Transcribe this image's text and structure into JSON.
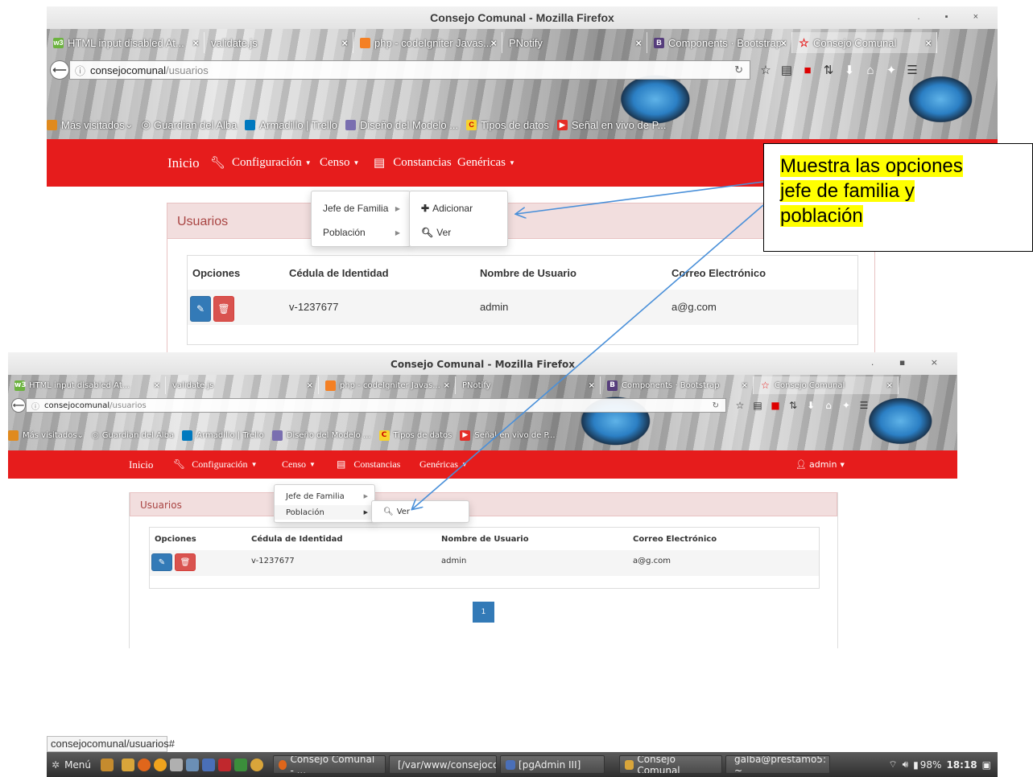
{
  "window1": {
    "title": "Consejo Comunal - Mozilla Firefox",
    "window_controls": ". ▪ ×",
    "tabs": [
      {
        "label": "HTML input disabled At...",
        "close": "×",
        "fav_color": "#6cb33f",
        "fav_text": "w3"
      },
      {
        "label": "validate.js",
        "close": "×",
        "fav_color": "",
        "fav_text": ""
      },
      {
        "label": "php - codeIgniter Javas...",
        "close": "×",
        "fav_color": "#f48024",
        "fav_text": ""
      },
      {
        "label": "PNotify",
        "close": "×",
        "fav_color": "",
        "fav_text": ""
      },
      {
        "label": "Components · Bootstrap",
        "close": "×",
        "fav_color": "#563d7c",
        "fav_text": "B"
      },
      {
        "label": "Consejo Comunal",
        "close": "×",
        "fav_color": "#e61c1c",
        "fav_text": "☆"
      }
    ],
    "url_host": "consejocomunal",
    "url_path": "/usuarios",
    "bookmarks": [
      "Más visitados",
      "Guardian del Alba",
      "Armadillo | Trello",
      "Diseño del Modelo ...",
      "Tipos de datos",
      "Señal en vivo de P..."
    ],
    "nav": {
      "brand": "Inicio",
      "configuracion": "Configuración",
      "censo": "Censo",
      "constancias": "Constancias",
      "genericas": "Genéricas"
    },
    "dropdown": [
      "Jefe de Familia",
      "Población"
    ],
    "submenu": [
      "Adicionar",
      "Ver"
    ],
    "panel_title": "Usuarios",
    "table": {
      "headers": [
        "Opciones",
        "Cédula de Identidad",
        "Nombre de Usuario",
        "Correo Electrónico"
      ],
      "row": {
        "cedula": "v-1237677",
        "usuario": "admin",
        "correo": "a@g.com"
      }
    }
  },
  "window2": {
    "title": "Consejo Comunal - Mozilla Firefox",
    "window_controls": ". ▪ ×",
    "tabs": [
      {
        "label": "HTML input disabled At...",
        "close": "×",
        "fav_color": "#6cb33f",
        "fav_text": "w3"
      },
      {
        "label": "validate.js",
        "close": "×",
        "fav_color": "",
        "fav_text": ""
      },
      {
        "label": "php - codeIgniter Javas...",
        "close": "×",
        "fav_color": "#f48024",
        "fav_text": ""
      },
      {
        "label": "PNotify",
        "close": "×",
        "fav_color": "",
        "fav_text": ""
      },
      {
        "label": "Components · Bootstrap",
        "close": "×",
        "fav_color": "#563d7c",
        "fav_text": "B"
      },
      {
        "label": "Consejo Comunal",
        "close": "×",
        "fav_color": "#e61c1c",
        "fav_text": "☆"
      }
    ],
    "url_host": "consejocomunal",
    "url_path": "/usuarios",
    "bookmarks": [
      "Más visitados",
      "Guardian del Alba",
      "Armadillo | Trello",
      "Diseño del Modelo ...",
      "Tipos de datos",
      "Señal en vivo de P..."
    ],
    "nav": {
      "brand": "Inicio",
      "configuracion": "Configuración",
      "censo": "Censo",
      "constancias": "Constancias",
      "genericas": "Genéricas",
      "user": "admin"
    },
    "dropdown": [
      "Jefe de Familia",
      "Población"
    ],
    "submenu": [
      "Ver"
    ],
    "panel_title": "Usuarios",
    "table": {
      "headers": [
        "Opciones",
        "Cédula de Identidad",
        "Nombre de Usuario",
        "Correo Electrónico"
      ],
      "row": {
        "cedula": "v-1237677",
        "usuario": "admin",
        "correo": "a@g.com"
      }
    },
    "pagination": "1"
  },
  "callout": {
    "lines": [
      "Muestra las opciones",
      "jefe de familia y",
      "población"
    ]
  },
  "status_url": "consejocomunal/usuarios#",
  "taskbar": {
    "menu": "Menú",
    "windows": [
      "Consejo Comunal - ...",
      "[/var/www/consejoco...",
      "[pgAdmin III]",
      "Consejo Comunal",
      "galba@prestamo5: ~"
    ],
    "battery": "98%",
    "clock": "18:18"
  },
  "colors": {
    "navbar": "#e61c1c",
    "panel_heading": "#f2dede",
    "primary": "#337ab7",
    "danger": "#d9534f",
    "callout_highlight": "#ffff00",
    "arrow": "#4a90d9"
  }
}
